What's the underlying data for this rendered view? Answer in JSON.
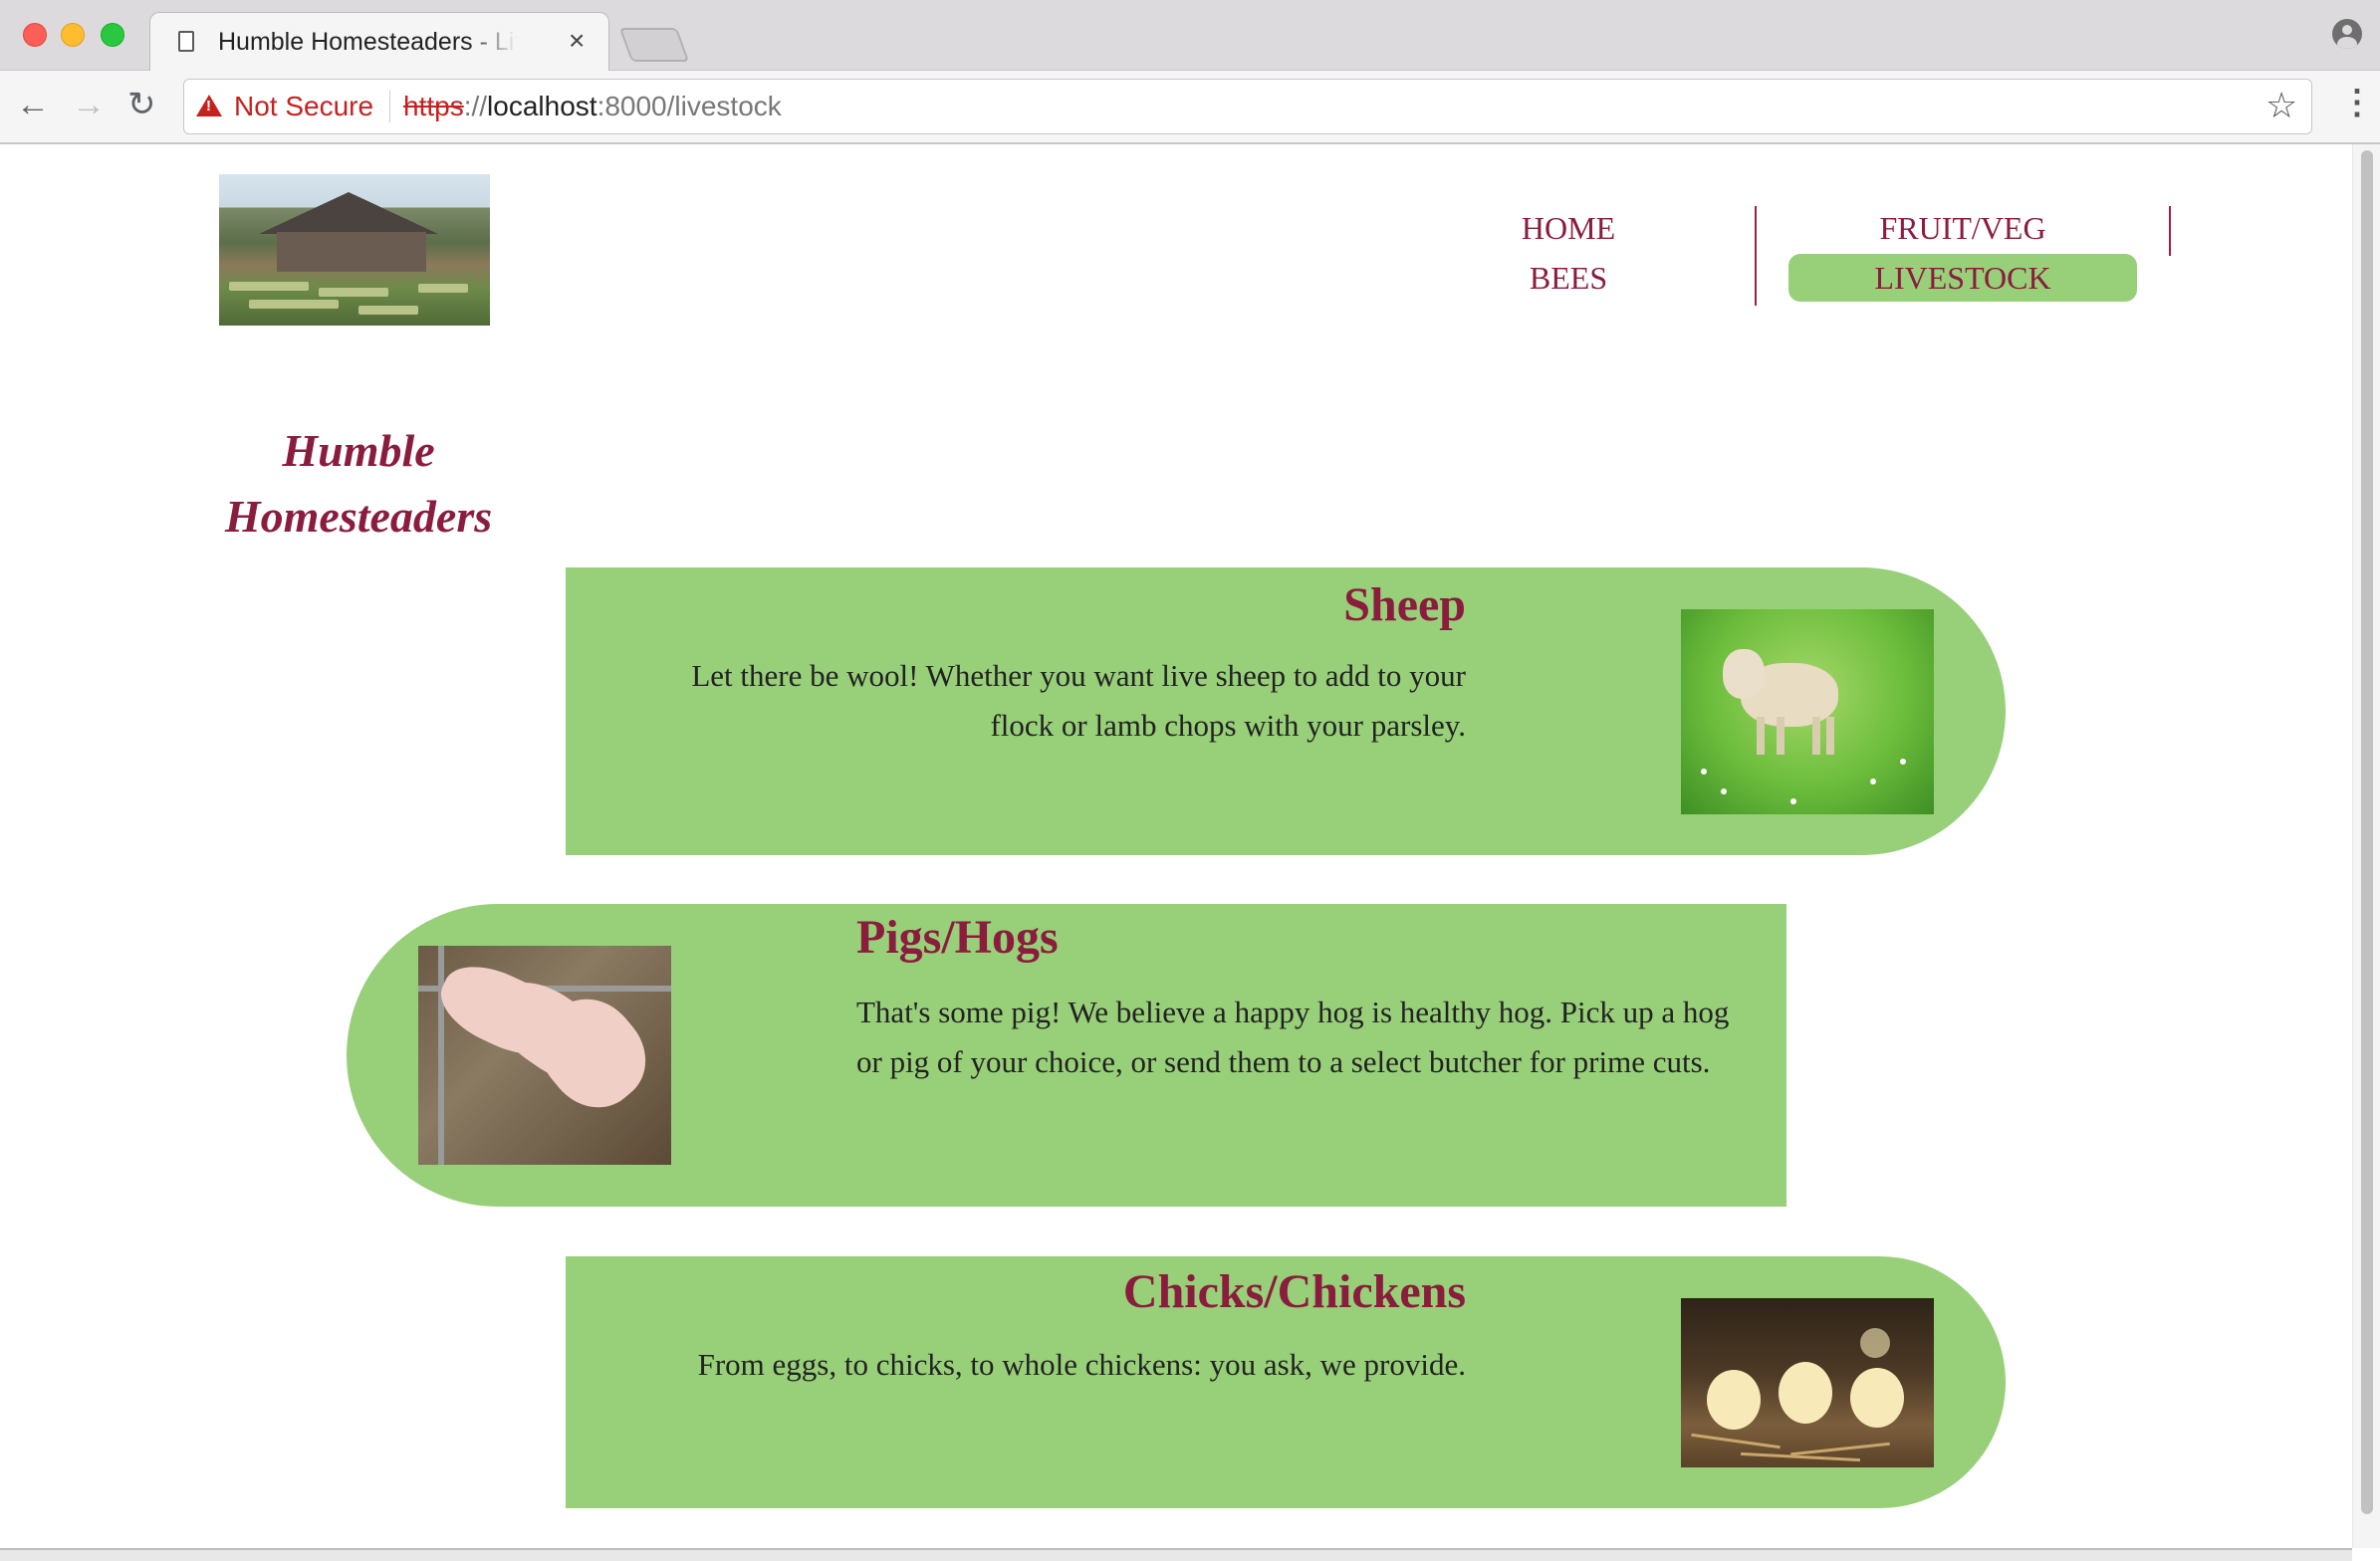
{
  "browser": {
    "tab_title": "Humble Homesteaders - Livestock",
    "tab_close": "×",
    "security_label": "Not Secure",
    "url_scheme": "https",
    "url_separator": "://",
    "url_host": "localhost",
    "url_rest": ":8000/livestock",
    "icons": {
      "back": "arrow-left-icon",
      "forward": "arrow-right-icon",
      "reload": "reload-icon",
      "warning": "warning-triangle-icon",
      "bookmark": "star-icon",
      "menu": "kebab-menu-icon",
      "profile": "profile-icon"
    }
  },
  "site": {
    "title_line1": "Humble",
    "title_line2": "Homesteaders",
    "accent_color": "#8a1d3e",
    "card_color": "#98cf79",
    "nav": [
      {
        "label": "HOME",
        "active": false
      },
      {
        "label": "FRUIT/VEG",
        "active": false
      },
      {
        "label": "BEES",
        "active": false
      },
      {
        "label": "LIVESTOCK",
        "active": true
      }
    ]
  },
  "cards": [
    {
      "title": "Sheep",
      "text": "Let there be wool! Whether you want live sheep to add to your flock or lamb chops with your parsley.",
      "image": "sheep-photo"
    },
    {
      "title": "Pigs/Hogs",
      "text": "That's some pig! We believe a happy hog is healthy hog. Pick up a hog or pig of your choice, or send them to a select butcher for prime cuts.",
      "image": "pigs-photo"
    },
    {
      "title": "Chicks/Chickens",
      "text": "From eggs, to chicks, to whole chickens: you ask, we provide.",
      "image": "chicks-photo"
    }
  ]
}
